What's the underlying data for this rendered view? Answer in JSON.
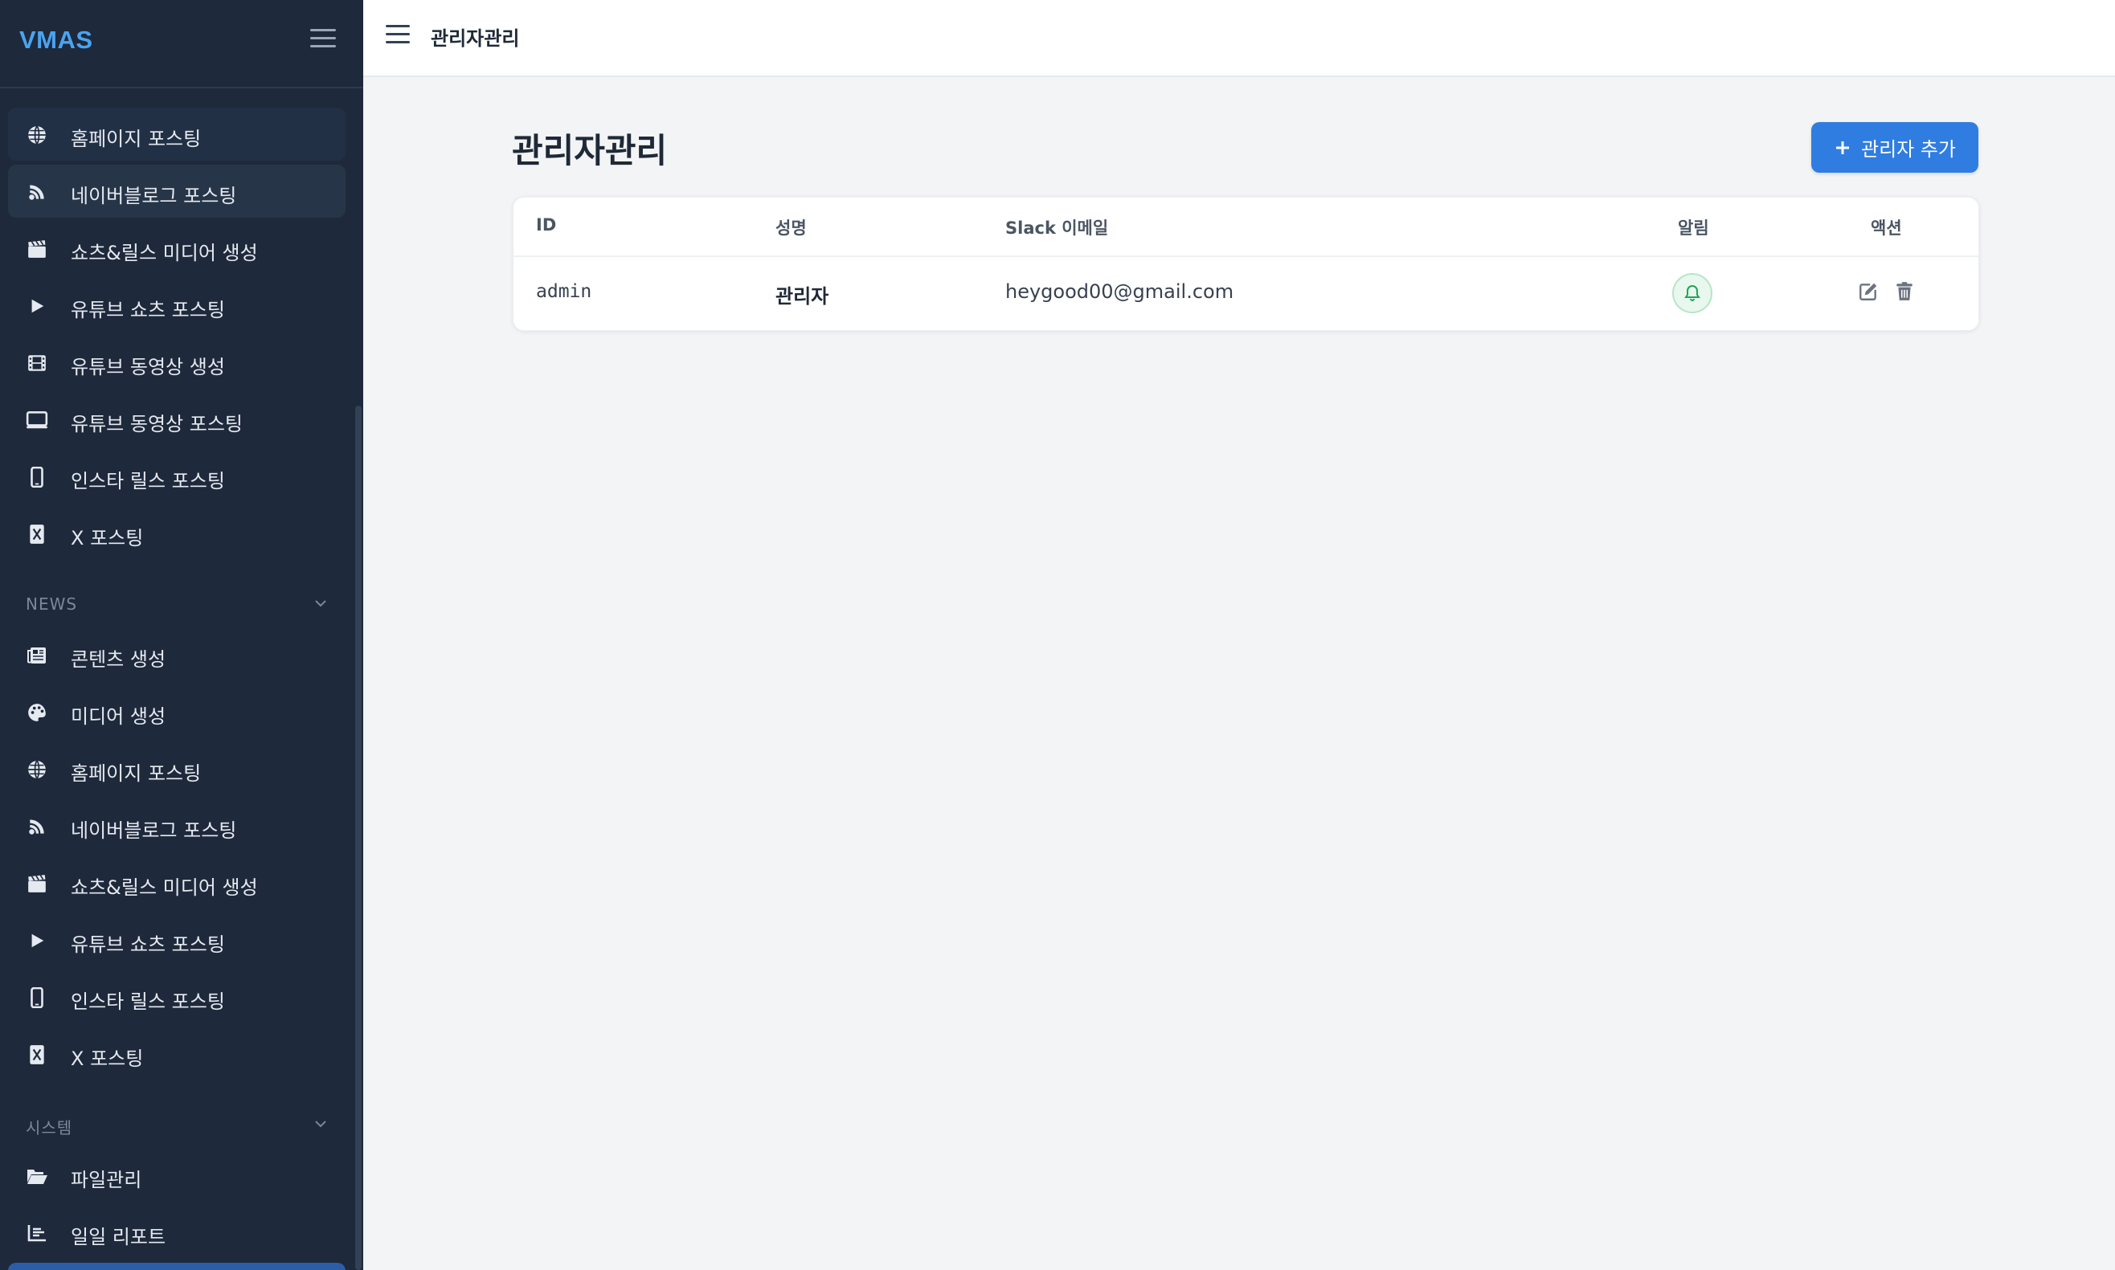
{
  "app": {
    "logo": "VMAS"
  },
  "sidebar": {
    "group1": [
      {
        "label": "홈페이지 포스팅",
        "icon": "globe-icon"
      },
      {
        "label": "네이버블로그 포스팅",
        "icon": "blog-icon"
      },
      {
        "label": "쇼츠&릴스 미디어 생성",
        "icon": "clapperboard-icon"
      },
      {
        "label": "유튜브 쇼츠 포스팅",
        "icon": "play-icon"
      },
      {
        "label": "유튜브 동영상 생성",
        "icon": "film-icon"
      },
      {
        "label": "유튜브 동영상 포스팅",
        "icon": "monitor-icon"
      },
      {
        "label": "인스타 릴스 포스팅",
        "icon": "phone-icon"
      },
      {
        "label": "X 포스팅",
        "icon": "x-icon"
      }
    ],
    "news": {
      "title": "NEWS",
      "items": [
        {
          "label": "콘텐츠 생성",
          "icon": "newspaper-icon"
        },
        {
          "label": "미디어 생성",
          "icon": "palette-icon"
        },
        {
          "label": "홈페이지 포스팅",
          "icon": "globe-icon"
        },
        {
          "label": "네이버블로그 포스팅",
          "icon": "blog-icon"
        },
        {
          "label": "쇼츠&릴스 미디어 생성",
          "icon": "clapperboard-icon"
        },
        {
          "label": "유튜브 쇼츠 포스팅",
          "icon": "play-icon"
        },
        {
          "label": "인스타 릴스 포스팅",
          "icon": "phone-icon"
        },
        {
          "label": "X 포스팅",
          "icon": "x-icon"
        }
      ]
    },
    "system": {
      "title": "시스템",
      "items": [
        {
          "label": "파일관리",
          "icon": "folder-open-icon"
        },
        {
          "label": "일일 리포트",
          "icon": "chart-icon"
        }
      ]
    }
  },
  "topbar": {
    "title": "관리자관리"
  },
  "main": {
    "title": "관리자관리",
    "add_button": "관리자 추가",
    "table": {
      "columns": [
        "ID",
        "성명",
        "Slack 이메일",
        "알림",
        "액션"
      ],
      "rows": [
        {
          "id": "admin",
          "name": "관리자",
          "email": "heygood00@gmail.com",
          "alert": "bell-icon"
        }
      ]
    }
  },
  "colors": {
    "sidebar_bg": "#1e293b",
    "accent": "#2f7de1",
    "logo": "#4aa3f0",
    "alert_green": "#22a35a"
  }
}
